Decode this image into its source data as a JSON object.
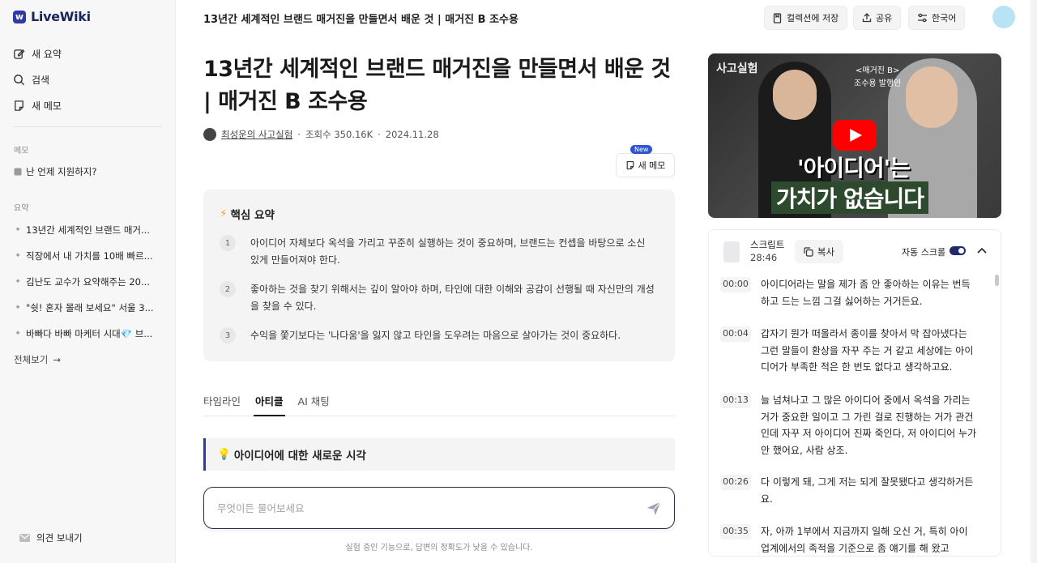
{
  "app": {
    "logo_mark": "w",
    "name": "LiveWiki"
  },
  "sidebar": {
    "nav": [
      {
        "label": "새 요약",
        "icon": "edit-icon"
      },
      {
        "label": "검색",
        "icon": "search-icon"
      },
      {
        "label": "새 메모",
        "icon": "note-icon"
      }
    ],
    "memo_section_label": "메모",
    "memo_items": [
      {
        "label": "난 언제 지원하지?"
      }
    ],
    "summary_section_label": "요약",
    "summary_items": [
      {
        "label": "13년간 세계적인 브랜드 매거..."
      },
      {
        "label": "직장에서 내 가치를 10배 빠르..."
      },
      {
        "label": "김난도 교수가 요약해주는 20..."
      },
      {
        "label": "\"쉿! 혼자 몰래 보세요\" 서울 3..."
      },
      {
        "label": "바빠다 바빠 마케터 시대💎 브..."
      }
    ],
    "see_all": "전체보기",
    "feedback": "의견 보내기"
  },
  "topbar": {
    "title": "13년간 세계적인 브랜드 매거진을 만들면서 배운 것 | 매거진 B 조수용",
    "save_label": "컬렉션에 저장",
    "share_label": "공유",
    "language_label": "한국어"
  },
  "article": {
    "title": "13년간 세계적인 브랜드 매거진을 만들면서 배운 것 | 매거진 B 조수용",
    "channel": "최성운의 사고실험",
    "views": "조회수 350.16K",
    "date": "2024.11.28",
    "new_badge": "New",
    "memo_button": "새 메모"
  },
  "summary": {
    "icon": "⚡",
    "heading": "핵심 요약",
    "items": [
      {
        "num": "1",
        "text": "아이디어 자체보다 옥석을 가리고 꾸준히 실행하는 것이 중요하며, 브랜드는 컨셉을 바탕으로 소신 있게 만들어져야 한다."
      },
      {
        "num": "2",
        "text": "좋아하는 것을 찾기 위해서는 깊이 알아야 하며, 타인에 대한 이해와 공감이 선행될 때 자신만의 개성을 찾을 수 있다."
      },
      {
        "num": "3",
        "text": "수익을 쫓기보다는 '나다움'을 잃지 않고 타인을 도우려는 마음으로 살아가는 것이 중요하다."
      }
    ]
  },
  "tabs": [
    {
      "label": "타임라인",
      "active": false
    },
    {
      "label": "아티클",
      "active": true
    },
    {
      "label": "AI 채팅",
      "active": false
    }
  ],
  "article_section": {
    "icon": "💡",
    "heading": "아이디어에 대한 새로운 시각"
  },
  "ask": {
    "placeholder": "무엇이든 물어보세요",
    "disclaimer": "실험 중인 기능으로, 답변의 정확도가 낮을 수 있습니다."
  },
  "video": {
    "channel_logo": "사고실험",
    "caption_small_1": "<매거진 B>",
    "caption_small_2": "조수용 발행인",
    "caption_line1": "'아이디어'는",
    "caption_line2": "가치가 없습니다"
  },
  "transcript": {
    "label": "스크립트",
    "duration": "28:46",
    "copy_label": "복사",
    "auto_scroll_label": "자동 스크롤",
    "auto_scroll_on": true,
    "lines": [
      {
        "ts": "00:00",
        "text": "아이디어라는 말을 제가 좀 안 좋아하는 이유는 번득하고 드는 느낌 그걸 싫어하는 거거든요."
      },
      {
        "ts": "00:04",
        "text": "갑자기 뭔가 떠올라서 종이를 찾아서 막 잡아냈다는 그런 말들이 환상을 자꾸 주는 거 같고 세상에는 아이디어가 부족한 적은 한 번도 없다고 생각하고요."
      },
      {
        "ts": "00:13",
        "text": "늘 넘쳐나고 그 많은 아이디어 중에서 옥석을 가리는 거가 중요한 일이고 그 가린 걸로 진행하는 거가 관건인데 자꾸 저 아이디어 진짜 죽인다, 저 아이디어 누가 안 했어요, 사람 상조."
      },
      {
        "ts": "00:26",
        "text": "다 이렇게 돼, 그게 저는 되게 잘못됐다고 생각하거든요."
      },
      {
        "ts": "00:35",
        "text": "자, 아까 1부에서 지금까지 일해 오신 거, 특히 아이 업계에서의 족적을 기준으로 좀 얘기를 해 왔고"
      }
    ]
  }
}
